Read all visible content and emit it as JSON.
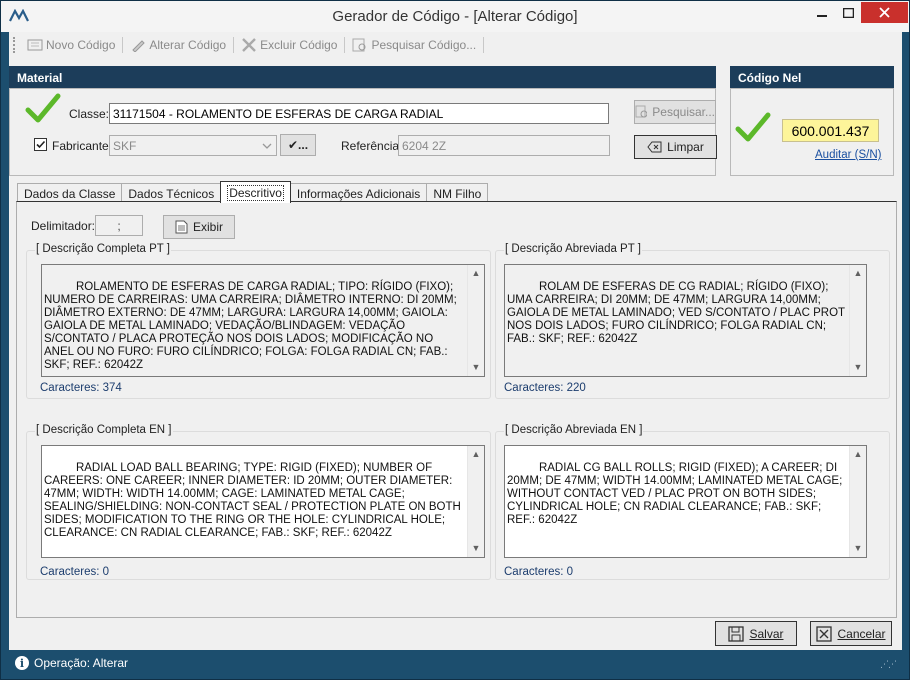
{
  "window": {
    "title": "Gerador de Código - [Alterar Código]",
    "minimize": "▬",
    "maximize": "☐",
    "close": "✕"
  },
  "toolbar": {
    "novo_codigo": "Novo Código",
    "alterar_codigo": "Alterar Código",
    "excluir_codigo": "Excluir Código",
    "pesquisar_codigo": "Pesquisar Código..."
  },
  "material": {
    "title": "Material",
    "classe_label": "Classe:",
    "classe_value": "31171504 - ROLAMENTO DE ESFERAS DE CARGA RADIAL",
    "fabricante_label": "Fabricante:",
    "fabricante_checked": true,
    "fabricante_value": "SKF",
    "fabricante_button": "✔...",
    "referencia_label": "Referência:",
    "referencia_value": "6204 2Z",
    "pesquisar_button": "Pesquisar...",
    "limpar_button": "Limpar"
  },
  "codigo_nel": {
    "title": "Código Nel",
    "value": "600.001.437",
    "auditar_link": "Auditar (S/N)"
  },
  "tabs": [
    {
      "label": "Dados da Classe",
      "active": false
    },
    {
      "label": "Dados Técnicos",
      "active": false
    },
    {
      "label": "Descritivo",
      "active": true
    },
    {
      "label": "Informações Adicionais",
      "active": false
    },
    {
      "label": "NM Filho",
      "active": false
    }
  ],
  "descritivo": {
    "delimitador_label": "Delimitador:",
    "delimitador_value": ";",
    "exibir_button": "Exibir",
    "completa_pt": {
      "title": "[ Descrição Completa PT ]",
      "text": "ROLAMENTO DE ESFERAS DE CARGA RADIAL; TIPO: RÍGIDO (FIXO); NUMERO DE CARREIRAS: UMA CARREIRA; DIÂMETRO INTERNO: DI 20MM; DIÂMETRO EXTERNO: DE 47MM; LARGURA: LARGURA 14,00MM; GAIOLA: GAIOLA DE METAL LAMINADO; VEDAÇÃO/BLINDAGEM: VEDAÇÃO S/CONTATO / PLACA PROTEÇÃO NOS DOIS LADOS; MODIFICAÇÃO NO ANEL OU NO FURO: FURO CILÍNDRICO; FOLGA: FOLGA RADIAL CN; FAB.: SKF; REF.: 62042Z",
      "count": "Caracteres: 374"
    },
    "abreviada_pt": {
      "title": "[ Descrição Abreviada PT ]",
      "text": "ROLAM DE ESFERAS DE CG RADIAL; RÍGIDO (FIXO); UMA CARREIRA; DI 20MM; DE 47MM; LARGURA 14,00MM; GAIOLA DE METAL LAMINADO; VED S/CONTATO / PLAC PROT NOS DOIS LADOS; FURO CILÍNDRICO; FOLGA RADIAL CN; FAB.: SKF; REF.: 62042Z",
      "count": "Caracteres: 220"
    },
    "completa_en": {
      "title": "[ Descrição Completa EN ]",
      "text": "RADIAL LOAD BALL BEARING; TYPE: RIGID (FIXED); NUMBER OF CAREERS: ONE CAREER; INNER DIAMETER: ID 20MM; OUTER DIAMETER: 47MM; WIDTH: WIDTH 14.00MM; CAGE: LAMINATED METAL CAGE; SEALING/SHIELDING: NON-CONTACT SEAL / PROTECTION PLATE ON BOTH SIDES; MODIFICATION TO THE RING OR THE HOLE: CYLINDRICAL HOLE; CLEARANCE: CN RADIAL CLEARANCE; FAB.: SKF; REF.: 62042Z",
      "count": "Caracteres: 0"
    },
    "abreviada_en": {
      "title": "[ Descrição Abreviada EN ]",
      "text": "RADIAL CG BALL ROLLS; RIGID (FIXED); A CAREER; DI 20MM; DE 47MM; WIDTH 14.00MM; LAMINATED METAL CAGE; WITHOUT CONTACT VED / PLAC PROT ON BOTH SIDES; CYLINDRICAL HOLE; CN RADIAL CLEARANCE; FAB.: SKF; REF.: 62042Z",
      "count": "Caracteres: 0"
    }
  },
  "footer": {
    "salvar_button": "Salvar",
    "cancelar_button": "Cancelar"
  },
  "status": {
    "text": "Operação: Alterar",
    "grip": "⋰⋰"
  },
  "colors": {
    "panel_header": "#1c3d5a",
    "statusbar": "#1c4e6e",
    "codigo_highlight": "#fdf59a",
    "check_green": "#5cb82a"
  }
}
